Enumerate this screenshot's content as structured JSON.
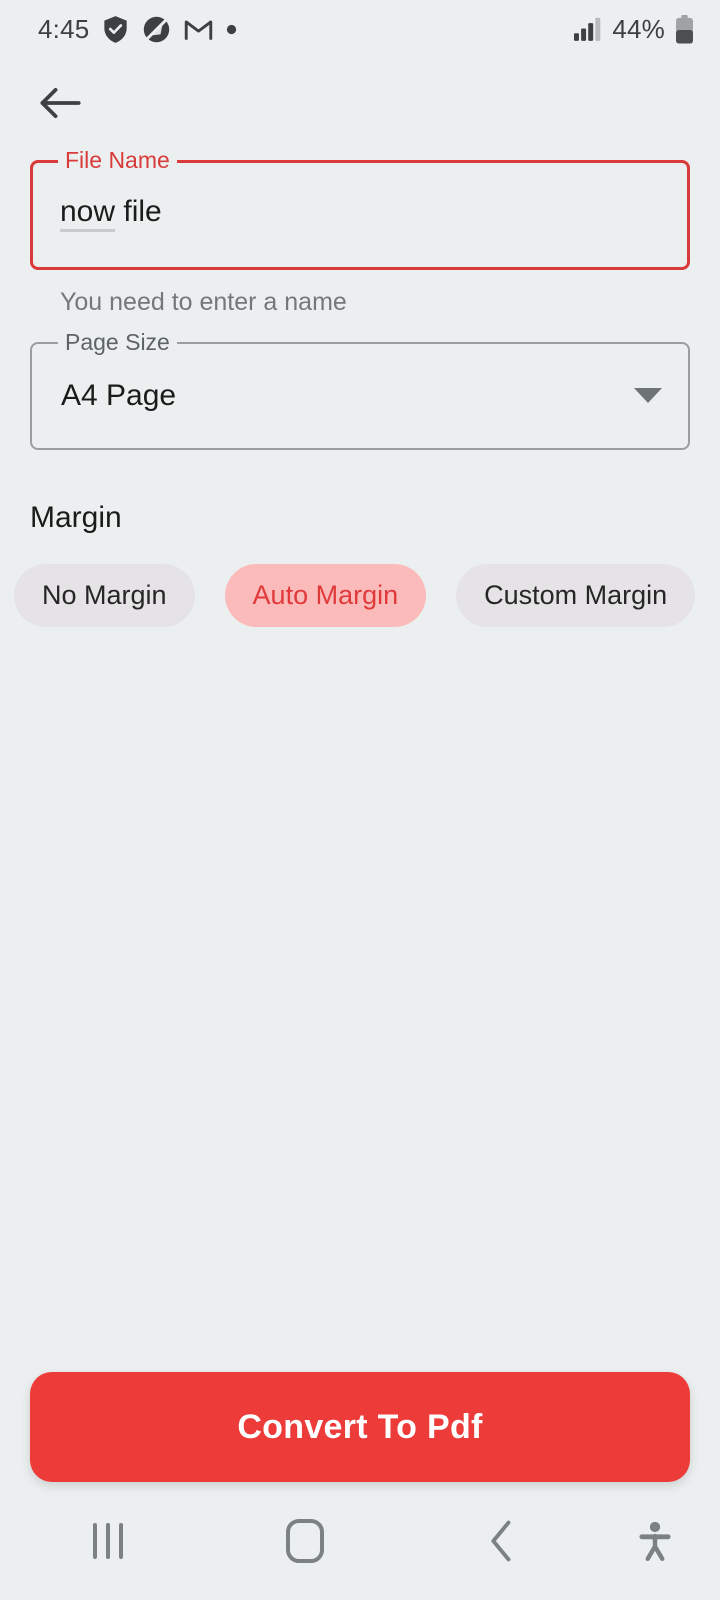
{
  "status_bar": {
    "time": "4:45",
    "icons": [
      "shield-check-icon",
      "do-not-disturb-icon",
      "gmail-icon",
      "dot-icon"
    ],
    "signal": "signal-bars-icon",
    "battery_percent": "44%",
    "battery": "battery-icon"
  },
  "app_bar": {
    "back": "back-arrow-icon"
  },
  "file_name_field": {
    "label": "File Name",
    "value": "now file",
    "value_misspelled": "now",
    "value_rest": " file",
    "helper": "You need to enter a name",
    "error_color": "#D93B3B"
  },
  "page_size_field": {
    "label": "Page Size",
    "value": "A4 Page",
    "arrow": "chevron-down-icon"
  },
  "margin_section": {
    "title": "Margin",
    "options": [
      {
        "label": "No Margin",
        "selected": false
      },
      {
        "label": "Auto Margin",
        "selected": true
      },
      {
        "label": "Custom Margin",
        "selected": false
      }
    ]
  },
  "cta": {
    "label": "Convert To Pdf",
    "color": "#ED3B39"
  },
  "nav_bar": {
    "recents": "recents-icon",
    "home": "home-icon",
    "back": "back-chevron-icon",
    "accessibility": "accessibility-icon"
  }
}
